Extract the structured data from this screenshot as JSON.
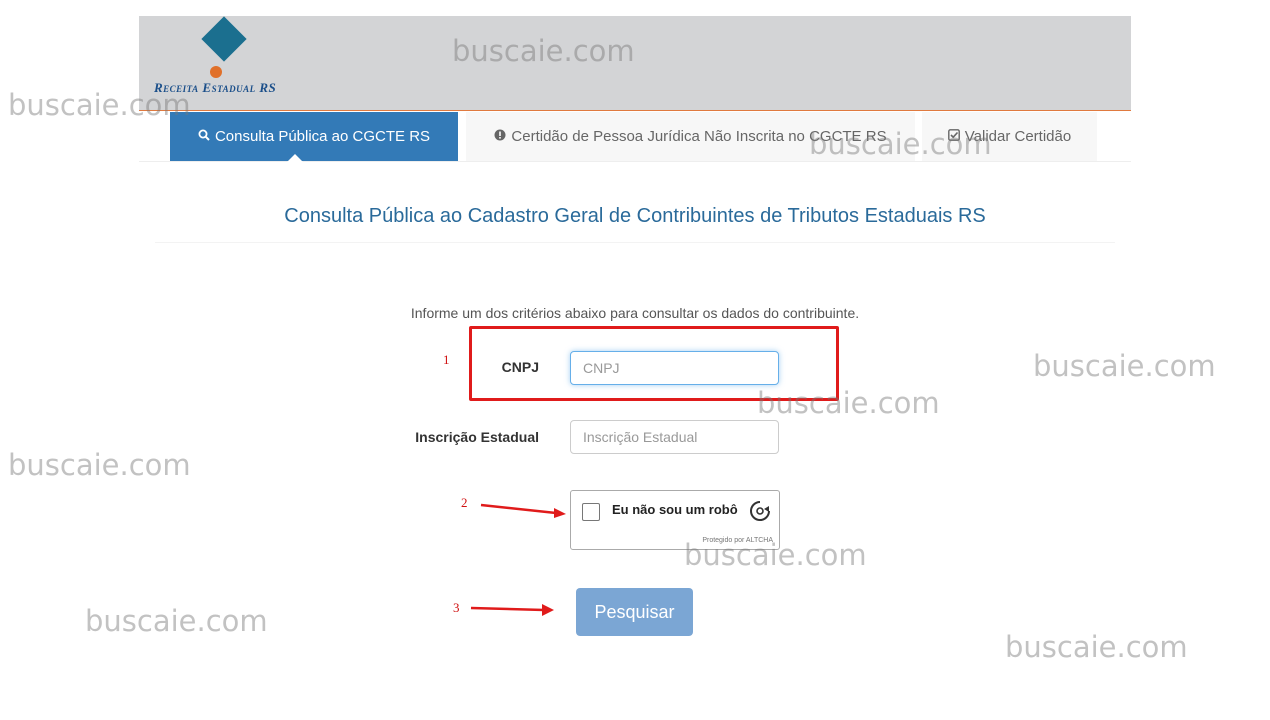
{
  "header": {
    "logo_text": "Receita Estadual RS"
  },
  "tabs": [
    {
      "icon": "search-icon",
      "label": "Consulta Pública ao CGCTE RS",
      "active": true
    },
    {
      "icon": "info-circle-icon",
      "label": "Certidão de Pessoa Jurídica Não Inscrita no CGCTE RS",
      "active": false
    },
    {
      "icon": "check-square-icon",
      "label": "Validar Certidão",
      "active": false
    }
  ],
  "main": {
    "title": "Consulta Pública ao Cadastro Geral de Contribuintes de Tributos Estaduais RS",
    "instructions": "Informe um dos critérios abaixo para consultar os dados do contribuinte.",
    "cnpj_label": "CNPJ",
    "cnpj_placeholder": "CNPJ",
    "ie_label": "Inscrição Estadual",
    "ie_placeholder": "Inscrição Estadual",
    "captcha_text": "Eu não sou um robô",
    "captcha_protected": "Protegido por ALTCHA",
    "search_button": "Pesquisar"
  },
  "annotations": {
    "step1": "1",
    "step2": "2",
    "step3": "3",
    "highlight_color": "#e01b1b"
  },
  "watermark": "buscaie.com",
  "colors": {
    "accent": "#337ab7",
    "button": "#7ba6d4",
    "header_bg": "#d3d4d6"
  }
}
